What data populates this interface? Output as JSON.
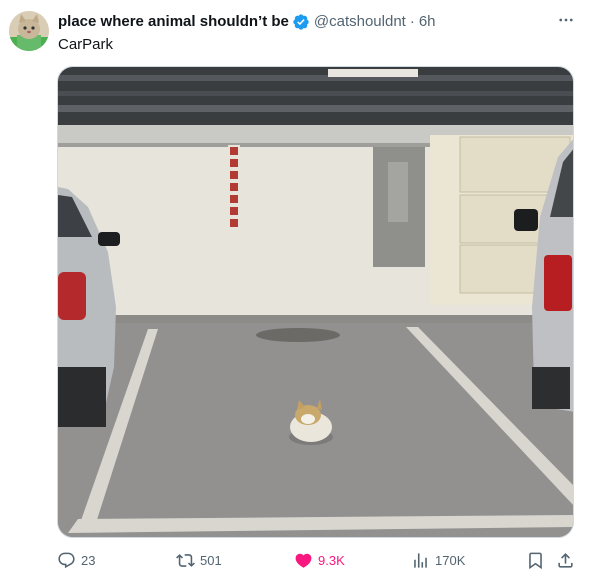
{
  "author": {
    "display_name": "place where animal shouldn’t be",
    "handle": "@catshouldnt",
    "separator": "·",
    "time": "6h",
    "verified_color": "#1d9bf0"
  },
  "tweet": {
    "text": "CarPark",
    "image_alt": "A cat sitting in the middle of an empty underground parking space"
  },
  "actions": {
    "replies": "23",
    "reposts": "501",
    "likes": "9.3K",
    "views": "170K",
    "liked": true,
    "like_color": "#f91880"
  },
  "colors": {
    "text_primary": "#0f1419",
    "text_secondary": "#536471",
    "border": "#cfd9de"
  }
}
